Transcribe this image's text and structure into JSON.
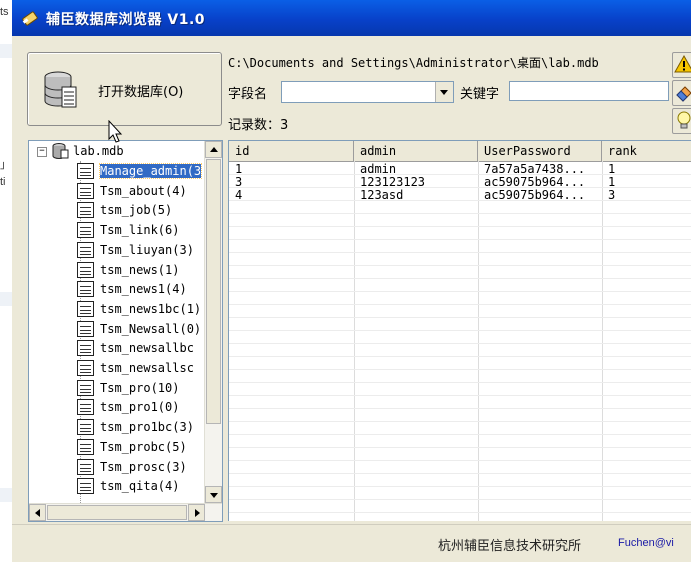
{
  "window": {
    "title": "辅臣数据库浏览器 V1.0"
  },
  "toolbar": {
    "open_db_label": "打开数据库(O)",
    "db_path": "C:\\Documents and Settings\\Administrator\\桌面\\lab.mdb",
    "field_label": "字段名",
    "field_value": "",
    "keyword_label": "关键字",
    "keyword_value": "",
    "record_count_label": "记录数：3"
  },
  "tree": {
    "root": "lab.mdb",
    "tables": [
      {
        "label": "Manage_admin(3",
        "selected": true
      },
      {
        "label": "Tsm_about(4)"
      },
      {
        "label": "tsm_job(5)"
      },
      {
        "label": "Tsm_link(6)"
      },
      {
        "label": "Tsm_liuyan(3)"
      },
      {
        "label": "tsm_news(1)"
      },
      {
        "label": "tsm_news1(4)"
      },
      {
        "label": "tsm_news1bc(1)"
      },
      {
        "label": "Tsm_Newsall(0)"
      },
      {
        "label": "tsm_newsallbc"
      },
      {
        "label": "tsm_newsallsc"
      },
      {
        "label": "Tsm_pro(10)"
      },
      {
        "label": "tsm_pro1(0)"
      },
      {
        "label": "tsm_pro1bc(3)"
      },
      {
        "label": "Tsm_probc(5)"
      },
      {
        "label": "Tsm_prosc(3)"
      },
      {
        "label": "tsm_qita(4)"
      }
    ]
  },
  "grid": {
    "columns": [
      "id",
      "admin",
      "UserPassword",
      "rank"
    ],
    "rows": [
      [
        "1",
        "admin",
        "7a57a5a7438...",
        "1"
      ],
      [
        "3",
        "123123123",
        "ac59075b964...",
        "1"
      ],
      [
        "4",
        "123asd",
        "ac59075b964...",
        "3"
      ]
    ]
  },
  "status": {
    "company": "杭州辅臣信息技术研究所",
    "watermark": "Fuchen@vi"
  },
  "background_window": {
    "fragments": [
      "ts",
      "」",
      "ti"
    ]
  },
  "colors": {
    "titlebar": "#0841c9",
    "selection": "#316ac5",
    "face": "#ece9d8"
  }
}
